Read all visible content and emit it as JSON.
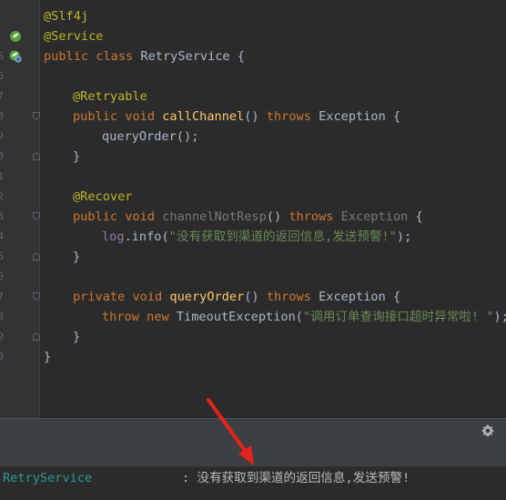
{
  "code": {
    "line1_ann": "@Slf4j",
    "line2_ann": "@Service",
    "line3_kw": "public class ",
    "line3_cls": "RetryService {",
    "line5_ann": "@Retryable",
    "line6_kw": "public void ",
    "line6_fn": "callChannel",
    "line6_paren": "() ",
    "line6_throws": "throws ",
    "line6_exc": "Exception {",
    "line7_call": "queryOrder();",
    "line8_brace": "}",
    "line10_ann": "@Recover",
    "line11_kw": "public void ",
    "line11_fn": "channelNotResp",
    "line11_paren": "() ",
    "line11_throws": "throws ",
    "line11_exc": "Exception",
    "line11_end": " {",
    "line12_log": "log",
    "line12_info": ".info(",
    "line12_str": "\"没有获取到渠道的返回信息,发送预警!\"",
    "line12_end": ");",
    "line13_brace": "}",
    "line15_kw": "private void ",
    "line15_fn": "queryOrder",
    "line15_paren": "() ",
    "line15_throws": "throws ",
    "line15_exc": "Exception {",
    "line16_throw": "throw new ",
    "line16_cls": "TimeoutException(",
    "line16_str": "\"调用订单查询接口超时异常啦! \"",
    "line16_end": ");",
    "line17_brace": "}",
    "line18_brace": "}"
  },
  "gutter": {
    "n0": "",
    "n1": "5",
    "n2": "6",
    "n3": "7",
    "n4": "8",
    "n5": "9",
    "n6": "0",
    "n7": "1",
    "n8": "2",
    "n9": "3",
    "n10": "4",
    "n11": "5",
    "n12": "6",
    "n13": "7",
    "n14": "8",
    "n15": "9",
    "n16": "0"
  },
  "console": {
    "logger": "RetryService",
    "message": ": 没有获取到渠道的返回信息,发送预警!"
  },
  "icons": {
    "gutter_bean": "spring-bean-icon",
    "gutter_bean_search": "spring-bean-search-icon",
    "settings": "gear-icon"
  },
  "colors": {
    "editor_bg": "#2b2b2b",
    "annotation": "#bbb529",
    "keyword": "#cc7832",
    "function": "#ffc66d",
    "string": "#6a8759",
    "field": "#9876aa",
    "logger": "#299999",
    "arrow": "#e8231c"
  }
}
